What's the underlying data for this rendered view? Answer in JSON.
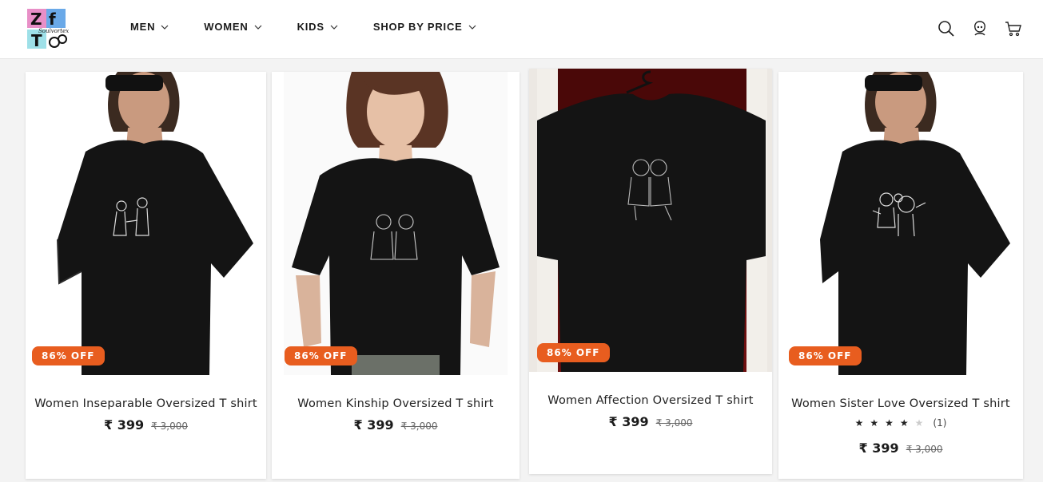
{
  "brand": {
    "logo_letters": [
      "Z",
      "f",
      "T"
    ],
    "logo_script": "Soulvortex"
  },
  "nav": [
    {
      "label": "MEN"
    },
    {
      "label": "WOMEN"
    },
    {
      "label": "KIDS"
    },
    {
      "label": "SHOP BY PRICE"
    }
  ],
  "header_icons": [
    "search-icon",
    "account-icon",
    "cart-icon"
  ],
  "accent_color": "#e85d1f",
  "products": [
    {
      "title": "Women Inseparable Oversized T shirt",
      "badge": "86% OFF",
      "price": "₹ 399",
      "mrp": "₹ 3,000"
    },
    {
      "title": "Women Kinship Oversized T shirt",
      "badge": "86% OFF",
      "price": "₹ 399",
      "mrp": "₹ 3,000"
    },
    {
      "title": "Women Affection Oversized T shirt",
      "badge": "86% OFF",
      "price": "₹ 399",
      "mrp": "₹ 3,000"
    },
    {
      "title": "Women Sister Love Oversized T shirt",
      "badge": "86% OFF",
      "price": "₹ 399",
      "mrp": "₹ 3,000",
      "rating": 4,
      "rating_max": 5,
      "reviews": "(1)"
    }
  ]
}
